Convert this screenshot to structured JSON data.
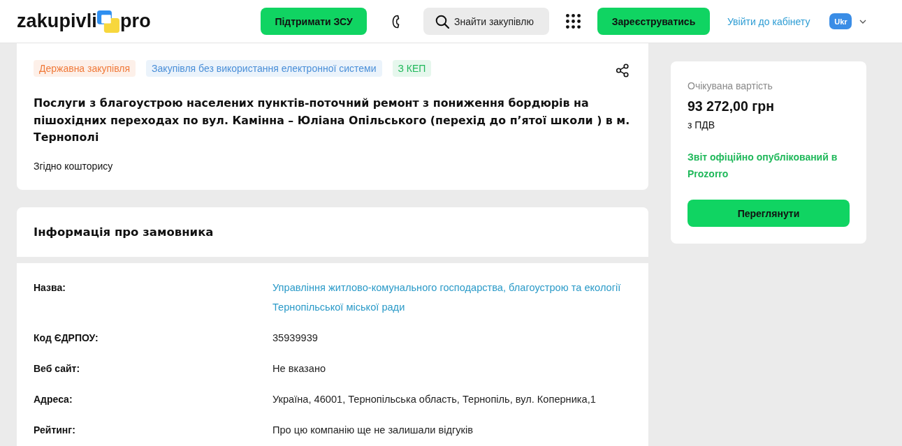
{
  "header": {
    "logo": {
      "name": "zakupivli",
      "suffix": "pro"
    },
    "support_button": "Підтримати ЗСУ",
    "search": {
      "placeholder": "Знайти закупівлю"
    },
    "register_button": "Зареєструватись",
    "login_link": "Увійти до кабінету",
    "language": "Ukr"
  },
  "tender": {
    "tags": [
      {
        "label": "Державна закупівля",
        "color": "#f07a3a"
      },
      {
        "label": "Закупівля без використання електронної системи",
        "color": "#4a8fd8"
      },
      {
        "label": "З КЕП",
        "color": "#1fb85a"
      }
    ],
    "title": "Послуги з благоустрою населених пунктів-поточний ремонт з пониження бордюрів на пішохідних переходах по вул. Камінна – Юліана Опільського (перехід до п’ятої школи ) в м. Тернополі",
    "description": "Згідно кошторису"
  },
  "customer": {
    "heading": "Інформація про замовника",
    "fields": [
      {
        "label": "Назва:",
        "value": "Управління житлово-комунального господарства, благоустрою та екології Тернопільської міської ради",
        "kind": "link"
      },
      {
        "label": "Код ЄДРПОУ:",
        "value": "35939939",
        "kind": "text"
      },
      {
        "label": "Веб сайт:",
        "value": "Не вказано",
        "kind": "text"
      },
      {
        "label": "Адреса:",
        "value": "Україна, 46001, Тернопільська область, Тернопіль, вул. Коперника,1",
        "kind": "text"
      },
      {
        "label": "Рейтинг:",
        "value": "Про цю компанію ще не залишали відгуків",
        "kind": "text"
      }
    ]
  },
  "price_card": {
    "label": "Очікувана вартість",
    "amount": "93 272,00 грн",
    "vat_note": "з ПДВ",
    "status": "Звіт офіційно опублікований в Prozorro",
    "button": "Переглянути"
  }
}
